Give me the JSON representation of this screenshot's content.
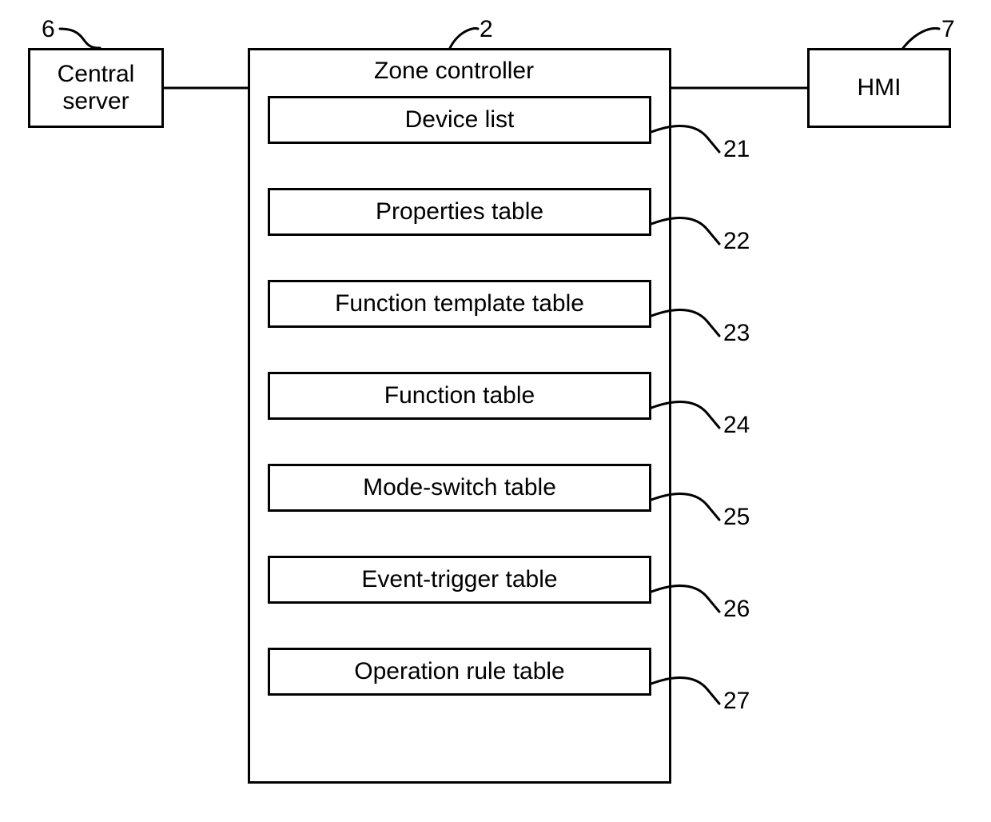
{
  "blocks": {
    "central_server": {
      "label": "Central\nserver",
      "ref": "6"
    },
    "hmi": {
      "label": "HMI",
      "ref": "7"
    },
    "zone_controller": {
      "title": "Zone controller",
      "ref": "2",
      "items": [
        {
          "label": "Device list",
          "ref": "21"
        },
        {
          "label": "Properties table",
          "ref": "22"
        },
        {
          "label": "Function template table",
          "ref": "23"
        },
        {
          "label": "Function table",
          "ref": "24"
        },
        {
          "label": "Mode-switch table",
          "ref": "25"
        },
        {
          "label": "Event-trigger table",
          "ref": "26"
        },
        {
          "label": "Operation rule table",
          "ref": "27"
        }
      ]
    }
  }
}
